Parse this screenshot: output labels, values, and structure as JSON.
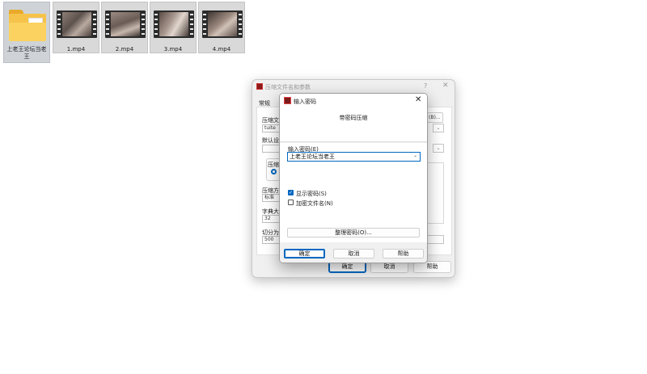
{
  "desktop": {
    "items": [
      {
        "label": "上老王论坛当老王",
        "icon": "folder-icon"
      },
      {
        "label": "1.mp4",
        "icon": "video-thumbnail"
      },
      {
        "label": "2.mp4",
        "icon": "video-thumbnail"
      },
      {
        "label": "3.mp4",
        "icon": "video-thumbnail"
      },
      {
        "label": "4.mp4",
        "icon": "video-thumbnail"
      }
    ]
  },
  "back_window": {
    "title": "压缩文件名和参数",
    "help_glyph": "?",
    "close_glyph": "✕",
    "tab_general": "常规",
    "archive_name_label": "压缩文",
    "archive_name_value": "tuite",
    "browse_label_partial": "(B)...",
    "default_profile_label": "默认设",
    "group_compress_label": "压缩",
    "method_label": "压缩方",
    "method_value": "标准",
    "dict_label": "字典大",
    "dict_value": "32",
    "split_label": "切分为",
    "split_value": "500",
    "combo_arrow": "⌄",
    "buttons": {
      "ok": "确定",
      "cancel": "取消",
      "help": "帮助"
    }
  },
  "password_dialog": {
    "title": "输入密码",
    "close_glyph": "✕",
    "heading": "带密码压缩",
    "input_label": "输入密码(E)",
    "input_value": "上老王论坛当老王",
    "dropdown_glyph": "⌄",
    "show_password": {
      "label": "显示密码(S)",
      "checked": true,
      "check_glyph": "✓"
    },
    "encrypt_filenames": {
      "label": "加密文件名(N)",
      "checked": false
    },
    "organize_button": "整理密码(O)...",
    "buttons": {
      "ok": "确定",
      "cancel": "取消",
      "help": "帮助"
    }
  },
  "colors": {
    "accent": "#0067c0",
    "folder": "#f6c34a",
    "dialog_bg": "#f0f0f0"
  }
}
